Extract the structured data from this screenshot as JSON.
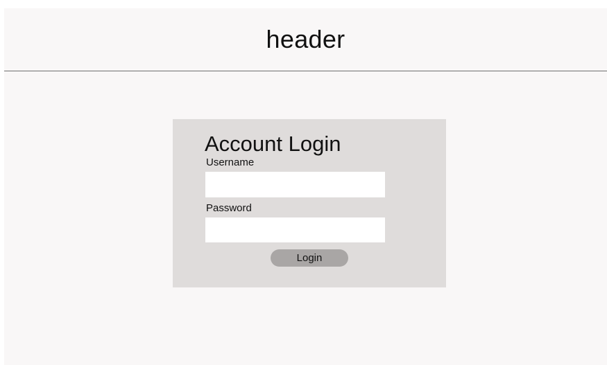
{
  "header": {
    "title": "header"
  },
  "login": {
    "title": "Account Login",
    "username_label": "Username",
    "username_value": "",
    "password_label": "Password",
    "password_value": "",
    "button_label": "Login"
  },
  "colors": {
    "page_background": "#f9f7f7",
    "header_divider": "#6f6f6f",
    "card_background": "#dfdcdb",
    "input_background": "#ffffff",
    "button_background": "#a9a6a5",
    "text": "#111111"
  }
}
